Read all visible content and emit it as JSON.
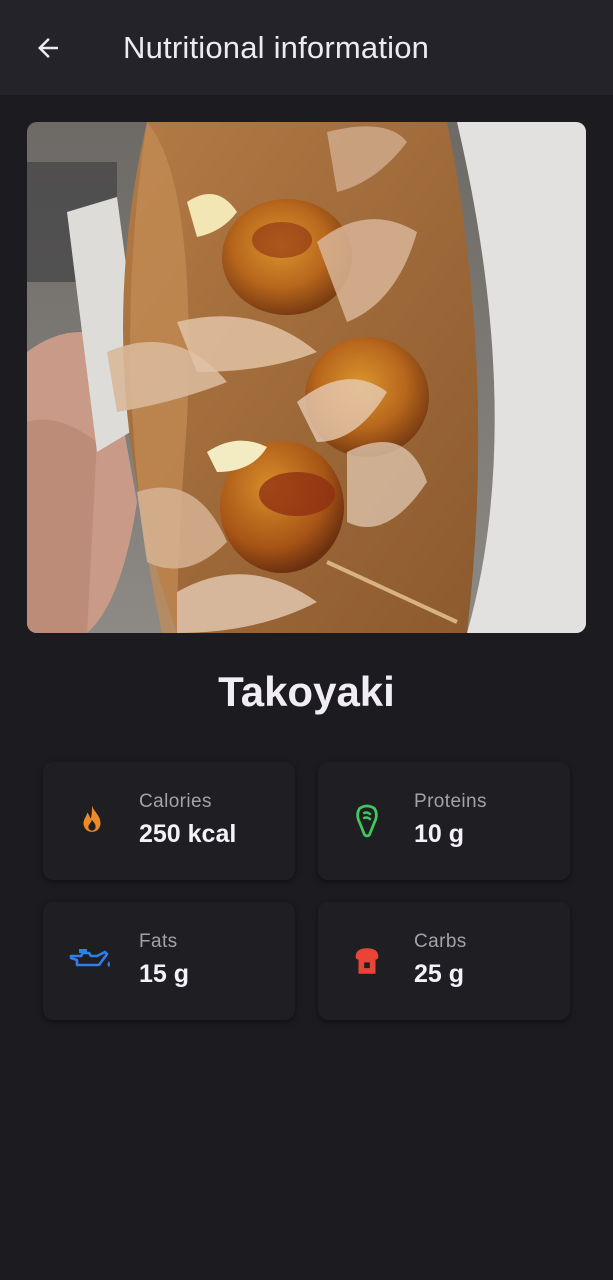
{
  "header": {
    "title": "Nutritional information",
    "back_icon": "arrow-left-icon"
  },
  "food": {
    "name": "Takoyaki",
    "photo_description_icon": "food-photo"
  },
  "nutrients": {
    "calories": {
      "label": "Calories",
      "value": "250 kcal",
      "icon": "flame-icon",
      "color": "#f08a24"
    },
    "proteins": {
      "label": "Proteins",
      "value": "10 g",
      "icon": "protein-icon",
      "color": "#3fc95a"
    },
    "fats": {
      "label": "Fats",
      "value": "15 g",
      "icon": "oil-can-icon",
      "color": "#2f7fe6"
    },
    "carbs": {
      "label": "Carbs",
      "value": "25 g",
      "icon": "bread-icon",
      "color": "#e84438"
    }
  }
}
